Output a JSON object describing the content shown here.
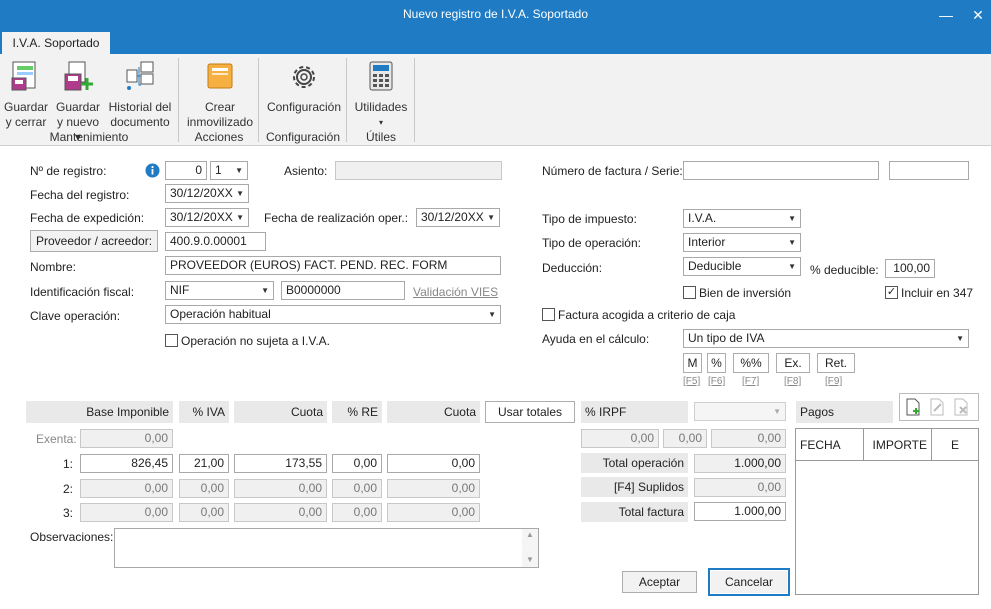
{
  "window": {
    "title": "Nuevo registro de I.V.A. Soportado"
  },
  "tab": {
    "label": "I.V.A. Soportado"
  },
  "ribbon": {
    "guardar_cerrar": [
      "Guardar",
      "y cerrar"
    ],
    "guardar_nuevo": [
      "Guardar",
      "y nuevo ▾"
    ],
    "historial": [
      "Historial del",
      "documento"
    ],
    "crear_inmovilizado": [
      "Crear",
      "inmovilizado"
    ],
    "configuracion": "Configuración",
    "utilidades": "Utilidades",
    "groups": {
      "mantenimiento": "Mantenimiento",
      "acciones": "Acciones",
      "configuracion": "Configuración",
      "utiles": "Útiles"
    }
  },
  "form": {
    "num_registro_label": "Nº de registro:",
    "num_registro_value": "0",
    "num_registro_select": "1",
    "asiento_label": "Asiento:",
    "num_factura_label": "Número de factura / Serie:",
    "fecha_registro_label": "Fecha del registro:",
    "fecha_registro_value": "30/12/20XX",
    "fecha_expedicion_label": "Fecha de expedición:",
    "fecha_expedicion_value": "30/12/20XX",
    "fecha_realizacion_label": "Fecha de realización oper.:",
    "fecha_realizacion_value": "30/12/20XX",
    "tipo_impuesto_label": "Tipo de impuesto:",
    "tipo_impuesto_value": "I.V.A.",
    "proveedor_button": "Proveedor / acreedor:",
    "proveedor_value": "400.9.0.00001",
    "tipo_operacion_label": "Tipo de operación:",
    "tipo_operacion_value": "Interior",
    "nombre_label": "Nombre:",
    "nombre_value": "PROVEEDOR (EUROS) FACT. PEND. REC. FORM",
    "deduccion_label": "Deducción:",
    "deduccion_value": "Deducible",
    "pct_deducible_label": "% deducible:",
    "pct_deducible_value": "100,00",
    "identificacion_label": "Identificación fiscal:",
    "identificacion_tipo": "NIF",
    "identificacion_value": "B0000000",
    "validacion_vies": "Validación VIES",
    "bien_inversion": "Bien de inversión",
    "incluir_347": "Incluir en 347",
    "clave_operacion_label": "Clave operación:",
    "clave_operacion_value": "Operación habitual",
    "factura_caja": "Factura acogida a criterio de caja",
    "no_sujeta": "Operación no sujeta a I.V.A.",
    "ayuda_label": "Ayuda en el cálculo:",
    "ayuda_value": "Un tipo de IVA",
    "calc_buttons": [
      {
        "label": "M",
        "key": "[F5]"
      },
      {
        "label": "%",
        "key": "[F6]"
      },
      {
        "label": "%%",
        "key": "[F7]"
      },
      {
        "label": "Ex.",
        "key": "[F8]"
      },
      {
        "label": "Ret.",
        "key": "[F9]"
      }
    ]
  },
  "grid": {
    "headers": {
      "base": "Base Imponible",
      "pct_iva": "% IVA",
      "cuota": "Cuota",
      "pct_re": "% RE",
      "cuota_re": "Cuota",
      "usar_totales": "Usar totales",
      "pct_irpf": "% IRPF"
    },
    "exenta_label": "Exenta:",
    "exenta_value": "0,00",
    "rows": [
      {
        "n": "1:",
        "base": "826,45",
        "iva": "21,00",
        "cuota": "173,55",
        "re": "0,00",
        "cuota_re": "0,00"
      },
      {
        "n": "2:",
        "base": "0,00",
        "iva": "0,00",
        "cuota": "0,00",
        "re": "0,00",
        "cuota_re": "0,00"
      },
      {
        "n": "3:",
        "base": "0,00",
        "iva": "0,00",
        "cuota": "0,00",
        "re": "0,00",
        "cuota_re": "0,00"
      }
    ],
    "irpf_values": [
      "0,00",
      "0,00",
      "0,00"
    ],
    "total_operacion_label": "Total operación",
    "total_operacion_value": "1.000,00",
    "suplidos_label": "[F4] Suplidos",
    "suplidos_value": "0,00",
    "total_factura_label": "Total factura",
    "total_factura_value": "1.000,00"
  },
  "pagos": {
    "title": "Pagos",
    "col_fecha": "FECHA",
    "col_importe": "IMPORTE",
    "col_e": "E"
  },
  "observaciones_label": "Observaciones:",
  "buttons": {
    "aceptar": "Aceptar",
    "cancelar": "Cancelar"
  },
  "colors": {
    "titlebar": "#1e7bc4",
    "info": "#1e7bc4"
  }
}
